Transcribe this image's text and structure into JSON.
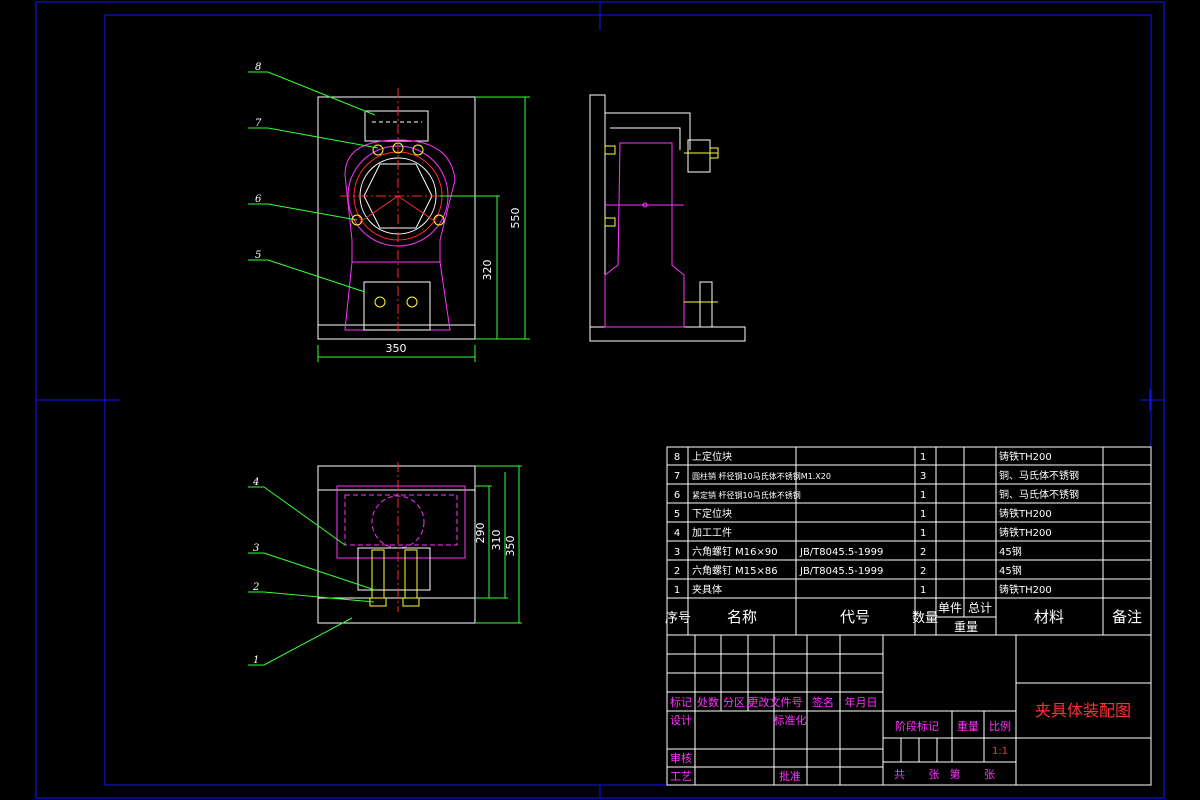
{
  "drawing": {
    "title": "夹具体装配图",
    "scale": "1:1",
    "sheet_label": "共 张第 张"
  },
  "dimensions": {
    "top_width": "350",
    "top_height_total": "550",
    "top_height_center": "320",
    "bottom_h1": "290",
    "bottom_h2": "310",
    "bottom_h3": "350"
  },
  "leaders": {
    "top": [
      "8",
      "7",
      "6",
      "5"
    ],
    "bottom": [
      "4",
      "3",
      "2",
      "1"
    ]
  },
  "bom": {
    "rows": [
      {
        "no": "8",
        "name": "上定位块",
        "code": "",
        "qty": "1",
        "material": "铸铁TH200"
      },
      {
        "no": "7",
        "name": "圆柱销 杆径钢10马氏体不锈钢M1.X20",
        "code": "",
        "qty": "3",
        "material": "铜、马氏体不锈钢"
      },
      {
        "no": "6",
        "name": "紧定销 杆径钢10马氏体不锈钢",
        "code": "",
        "qty": "1",
        "material": "铜、马氏体不锈钢"
      },
      {
        "no": "5",
        "name": "下定位块",
        "code": "",
        "qty": "1",
        "material": "铸铁TH200"
      },
      {
        "no": "4",
        "name": "加工工件",
        "code": "",
        "qty": "1",
        "material": "铸铁TH200"
      },
      {
        "no": "3",
        "name": "六角螺钉 M16×90",
        "code": "JB/T8045.5-1999",
        "qty": "2",
        "material": "45钢"
      },
      {
        "no": "2",
        "name": "六角螺钉 M15×86",
        "code": "JB/T8045.5-1999",
        "qty": "2",
        "material": "45钢"
      },
      {
        "no": "1",
        "name": "夹具体",
        "code": "",
        "qty": "1",
        "material": "铸铁TH200"
      }
    ],
    "header": {
      "no": "序号",
      "name": "名称",
      "code": "代号",
      "qty": "数量",
      "unit": "单件",
      "total": "总计",
      "weight": "重量",
      "material": "材料",
      "remark": "备注"
    }
  },
  "title_block": {
    "mark": "标记",
    "count": "处数",
    "zone": "分区",
    "doc": "更改文件号",
    "sign": "签名",
    "date": "年月日",
    "design": "设计",
    "standard": "标准化",
    "stage": "阶段标记",
    "weight": "重量",
    "ratio": "比例",
    "review": "审核",
    "process": "工艺",
    "approve": "批准"
  },
  "colors": {
    "background": "#000000",
    "frame": "#1515ff",
    "outline": "#ffffff",
    "part": "#ff33ff",
    "center": "#ff2a2a",
    "dimension": "#33ff33",
    "title_red": "#ff3333"
  }
}
